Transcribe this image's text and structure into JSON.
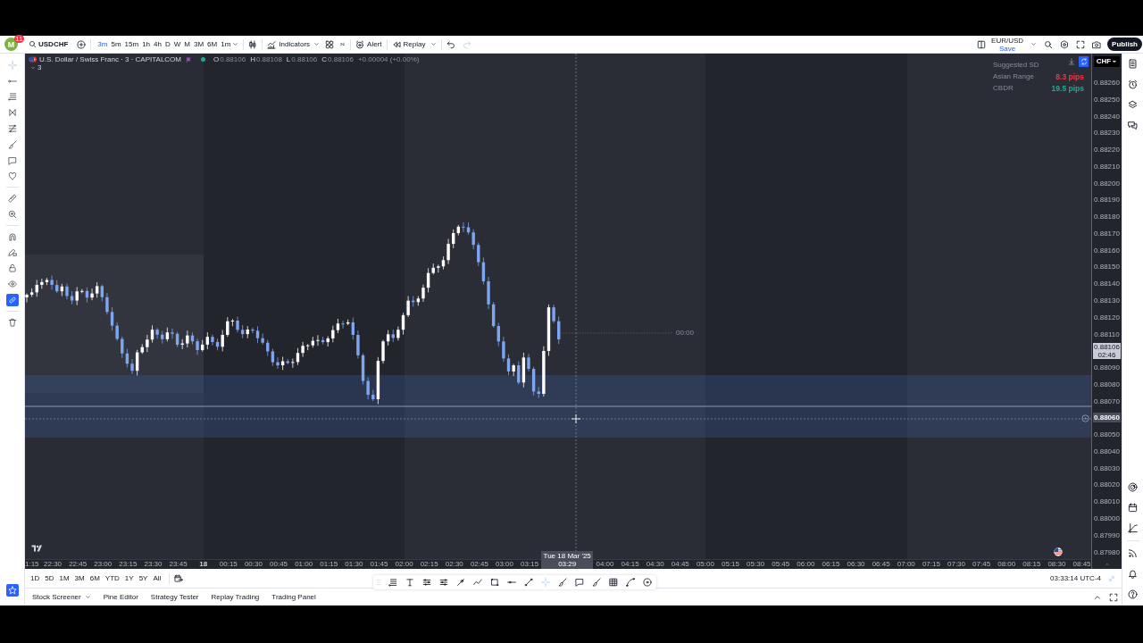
{
  "top_toolbar": {
    "avatar": {
      "initial": "M",
      "badge": "11"
    },
    "symbol": "USDCHF",
    "intervals": [
      {
        "label": "3m",
        "selected": true
      },
      {
        "label": "5m",
        "selected": false
      },
      {
        "label": "15m",
        "selected": false
      },
      {
        "label": "1h",
        "selected": false
      },
      {
        "label": "4h",
        "selected": false
      },
      {
        "label": "D",
        "selected": false
      },
      {
        "label": "W",
        "selected": false
      },
      {
        "label": "M",
        "selected": false
      },
      {
        "label": "3M",
        "selected": false
      },
      {
        "label": "6M",
        "selected": false
      },
      {
        "label": "1m",
        "selected": false
      }
    ],
    "indicators": "Indicators",
    "alert": "Alert",
    "replay": "Replay",
    "undo": {
      "disabled": false
    },
    "redo": {
      "disabled": true
    },
    "layout": {
      "name": "EUR/USD",
      "status": "Save"
    },
    "publish": "Publish"
  },
  "left_toolbar": {
    "tools": [
      {
        "selected": false
      },
      {
        "selected": false
      },
      {
        "selected": false
      },
      {
        "selected": false
      },
      {
        "selected": false
      },
      {
        "selected": false
      },
      {
        "selected": false
      },
      {
        "selected": false
      },
      {
        "selected": false
      },
      {
        "selected": false
      },
      {
        "selected": false
      },
      {
        "selected": false
      },
      {
        "selected": false
      },
      {
        "selected": false
      },
      {
        "selected": true
      },
      {
        "selected": false
      }
    ],
    "favorites": {
      "on": true
    }
  },
  "chart": {
    "legend": {
      "title": "U.S. Dollar / Swiss Franc · 3 · CAPITALCOM",
      "market_open": true,
      "values": [
        {
          "key": "O",
          "value": "0.88106"
        },
        {
          "key": "H",
          "value": "0.88108"
        },
        {
          "key": "L",
          "value": "0.88106"
        },
        {
          "key": "C",
          "value": "0.88106"
        }
      ],
      "change": "+0.00004 (+0.00%)",
      "indicator_count": "3"
    },
    "info_table": [
      {
        "label": "Suggested SD"
      },
      {
        "label": "Asian Range",
        "value": "8.3 pips",
        "color": "#f23645"
      },
      {
        "label": "CBDR",
        "value": "19.5 pips",
        "color": "#22ab94"
      }
    ],
    "marker_label": "00:00"
  },
  "price_axis": {
    "currency": "CHF",
    "labels": [
      {
        "kind": "tick",
        "text": "0.88260"
      },
      {
        "kind": "tick",
        "text": "0.88250"
      },
      {
        "kind": "tick",
        "text": "0.88240"
      },
      {
        "kind": "tick",
        "text": "0.88230"
      },
      {
        "kind": "tick",
        "text": "0.88220"
      },
      {
        "kind": "tick",
        "text": "0.88210"
      },
      {
        "kind": "tick",
        "text": "0.88200"
      },
      {
        "kind": "tick",
        "text": "0.88190"
      },
      {
        "kind": "tick",
        "text": "0.88180"
      },
      {
        "kind": "tick",
        "text": "0.88170"
      },
      {
        "kind": "tick",
        "text": "0.88160"
      },
      {
        "kind": "tick",
        "text": "0.88150"
      },
      {
        "kind": "tick",
        "text": "0.88140"
      },
      {
        "kind": "tick",
        "text": "0.88130"
      },
      {
        "kind": "tick",
        "text": "0.88120"
      },
      {
        "kind": "tick",
        "text": "0.88110"
      },
      {
        "kind": "last_price",
        "text": "0.88106",
        "countdown": "02:46"
      },
      {
        "kind": "tick",
        "text": "0.88090"
      },
      {
        "kind": "tick",
        "text": "0.88080"
      },
      {
        "kind": "tick",
        "text": "0.88070"
      },
      {
        "kind": "crosshair",
        "text": "0.88060"
      },
      {
        "kind": "tick",
        "text": "0.88050"
      },
      {
        "kind": "tick",
        "text": "0.88040"
      },
      {
        "kind": "tick",
        "text": "0.88030"
      },
      {
        "kind": "tick",
        "text": "0.88020"
      },
      {
        "kind": "tick",
        "text": "0.88010"
      },
      {
        "kind": "tick",
        "text": "0.88000"
      },
      {
        "kind": "tick",
        "text": "0.87990"
      },
      {
        "kind": "tick",
        "text": "0.87980"
      }
    ]
  },
  "time_axis": {
    "labels": [
      {
        "kind": "partial",
        "text": "1:15"
      },
      {
        "kind": "tick",
        "text": "22:30"
      },
      {
        "kind": "tick",
        "text": "22:45"
      },
      {
        "kind": "tick",
        "text": "23:00"
      },
      {
        "kind": "tick",
        "text": "23:15"
      },
      {
        "kind": "tick",
        "text": "23:30"
      },
      {
        "kind": "tick",
        "text": "23:45"
      },
      {
        "kind": "day",
        "text": "18"
      },
      {
        "kind": "tick",
        "text": "00:15"
      },
      {
        "kind": "tick",
        "text": "00:30"
      },
      {
        "kind": "tick",
        "text": "00:45"
      },
      {
        "kind": "tick",
        "text": "01:00"
      },
      {
        "kind": "tick",
        "text": "01:15"
      },
      {
        "kind": "tick",
        "text": "01:30"
      },
      {
        "kind": "tick",
        "text": "01:45"
      },
      {
        "kind": "tick",
        "text": "02:00"
      },
      {
        "kind": "tick",
        "text": "02:15"
      },
      {
        "kind": "tick",
        "text": "02:30"
      },
      {
        "kind": "tick",
        "text": "02:45"
      },
      {
        "kind": "tick",
        "text": "03:00"
      },
      {
        "kind": "tick",
        "text": "03:15"
      },
      {
        "kind": "crosshair",
        "text": "Tue 18 Mar '25 03:29"
      },
      {
        "kind": "tick",
        "text": "04:00"
      },
      {
        "kind": "tick",
        "text": "04:15"
      },
      {
        "kind": "tick",
        "text": "04:30"
      },
      {
        "kind": "tick",
        "text": "04:45"
      },
      {
        "kind": "tick",
        "text": "05:00"
      },
      {
        "kind": "tick",
        "text": "05:15"
      },
      {
        "kind": "tick",
        "text": "05:30"
      },
      {
        "kind": "tick",
        "text": "05:45"
      },
      {
        "kind": "tick",
        "text": "06:00"
      },
      {
        "kind": "tick",
        "text": "06:15"
      },
      {
        "kind": "tick",
        "text": "06:30"
      },
      {
        "kind": "tick",
        "text": "06:45"
      },
      {
        "kind": "tick",
        "text": "07:00"
      },
      {
        "kind": "tick",
        "text": "07:15"
      },
      {
        "kind": "tick",
        "text": "07:30"
      },
      {
        "kind": "tick",
        "text": "07:45"
      },
      {
        "kind": "tick",
        "text": "08:00"
      },
      {
        "kind": "tick",
        "text": "08:15"
      },
      {
        "kind": "tick",
        "text": "08:30"
      },
      {
        "kind": "tick",
        "text": "08:45"
      }
    ]
  },
  "bottom_toolbar": {
    "ranges": [
      {
        "label": "1D",
        "selected": false
      },
      {
        "label": "5D",
        "selected": false
      },
      {
        "label": "1M",
        "selected": false
      },
      {
        "label": "3M",
        "selected": false
      },
      {
        "label": "6M",
        "selected": false
      },
      {
        "label": "YTD",
        "selected": false
      },
      {
        "label": "1Y",
        "selected": false
      },
      {
        "label": "5Y",
        "selected": false
      },
      {
        "label": "All",
        "selected": false
      }
    ],
    "clock": "03:33:14 UTC-4"
  },
  "panel_tabs": [
    {
      "label": "Stock Screener",
      "dropdown": true,
      "selected": false
    },
    {
      "label": "Pine Editor",
      "dropdown": false,
      "selected": false
    },
    {
      "label": "Strategy Tester",
      "dropdown": false,
      "selected": false
    },
    {
      "label": "Replay Trading",
      "dropdown": false,
      "selected": false
    },
    {
      "label": "Trading Panel",
      "dropdown": false,
      "selected": false
    }
  ]
}
